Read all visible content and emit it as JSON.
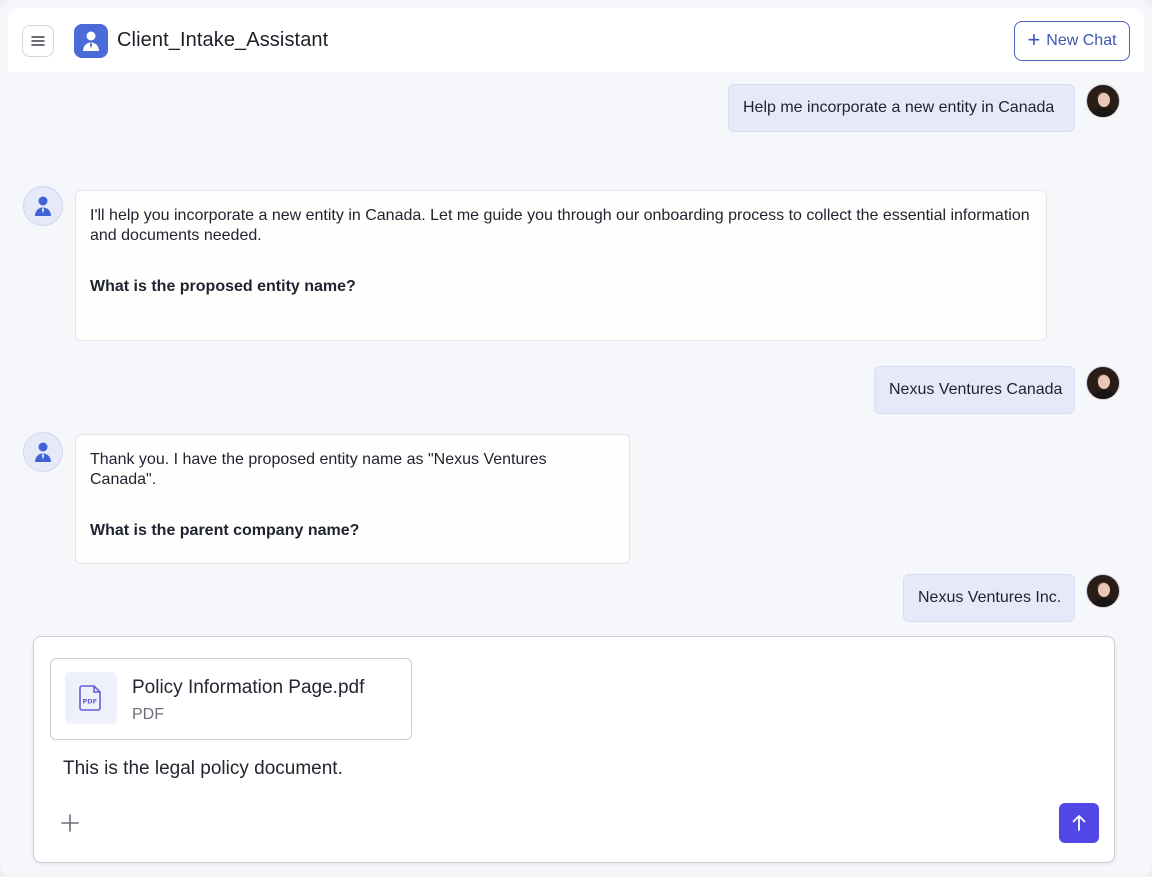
{
  "header": {
    "title": "Client_Intake_Assistant",
    "new_chat_label": "New Chat"
  },
  "messages": [
    {
      "role": "user",
      "text": "Help me incorporate a new entity in Canada"
    },
    {
      "role": "assistant",
      "text": "I'll help you incorporate a new entity in Canada. Let me guide you through our onboarding process to collect the essential information and documents needed.",
      "question": "What is the proposed entity name?"
    },
    {
      "role": "user",
      "text": "Nexus Ventures Canada"
    },
    {
      "role": "assistant",
      "text": "Thank you. I have the proposed entity name as \"Nexus Ventures Canada\".",
      "question": "What is the parent company name?"
    },
    {
      "role": "user",
      "text": "Nexus Ventures Inc."
    }
  ],
  "composer": {
    "attachment": {
      "name": "Policy Information Page.pdf",
      "type": "PDF"
    },
    "text": "This is the legal policy document."
  },
  "icons": {
    "menu": "hamburger-icon",
    "logo": "assistant-person-icon",
    "new_chat": "plus-icon",
    "file": "pdf-file-icon",
    "attach": "plus-icon",
    "send": "arrow-up-icon"
  },
  "colors": {
    "accent": "#4a6bd8",
    "send": "#5047e6",
    "user_bubble": "#e6e9fa",
    "bot_bubble": "#fefefc"
  }
}
